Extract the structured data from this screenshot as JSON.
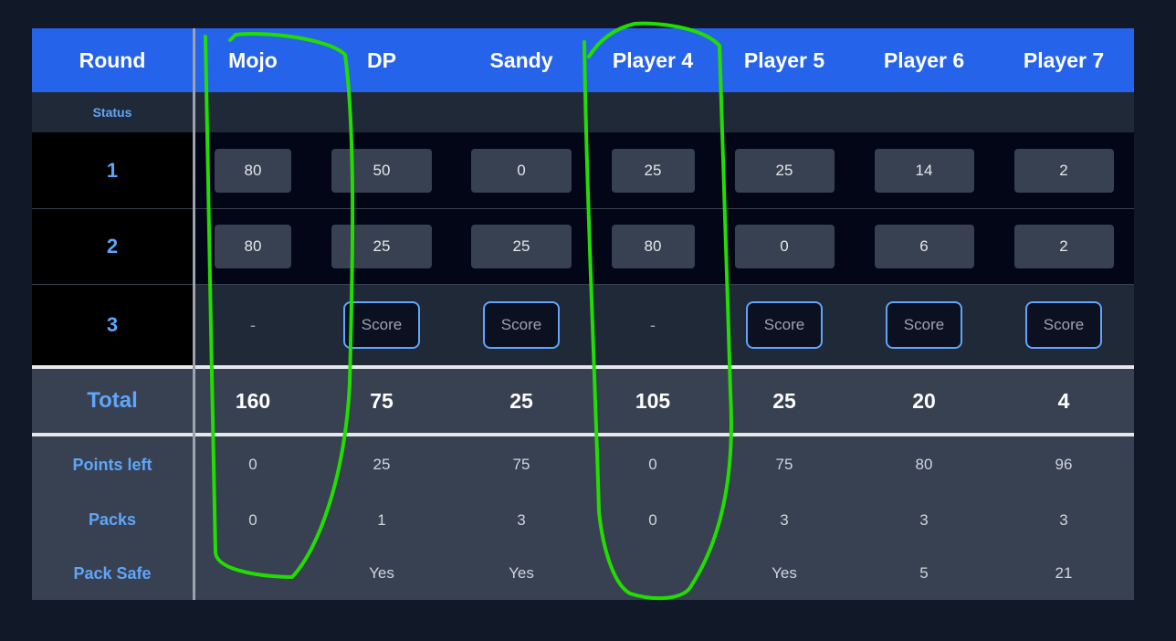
{
  "header": {
    "round_label": "Round",
    "players": [
      "Mojo",
      "DP",
      "Sandy",
      "Player 4",
      "Player 5",
      "Player 6",
      "Player 7"
    ]
  },
  "status_label": "Status",
  "rounds": [
    {
      "label": "1",
      "scores": [
        "80",
        "50",
        "0",
        "25",
        "25",
        "14",
        "2"
      ]
    },
    {
      "label": "2",
      "scores": [
        "80",
        "25",
        "25",
        "80",
        "0",
        "6",
        "2"
      ]
    },
    {
      "label": "3",
      "scores": [
        "-",
        "Score",
        "Score",
        "-",
        "Score",
        "Score",
        "Score"
      ]
    }
  ],
  "total": {
    "label": "Total",
    "values": [
      "160",
      "75",
      "25",
      "105",
      "25",
      "20",
      "4"
    ]
  },
  "points_left": {
    "label": "Points left",
    "values": [
      "0",
      "25",
      "75",
      "0",
      "75",
      "80",
      "96"
    ]
  },
  "packs": {
    "label": "Packs",
    "values": [
      "0",
      "1",
      "3",
      "0",
      "3",
      "3",
      "3"
    ]
  },
  "pack_safe": {
    "label": "Pack Safe",
    "values": [
      "",
      "Yes",
      "Yes",
      "",
      "Yes",
      "5",
      "21"
    ]
  },
  "colors": {
    "header_bg": "#2563eb",
    "accent": "#60a5fa",
    "annotation": "#22dd00",
    "page_bg": "#111827"
  }
}
